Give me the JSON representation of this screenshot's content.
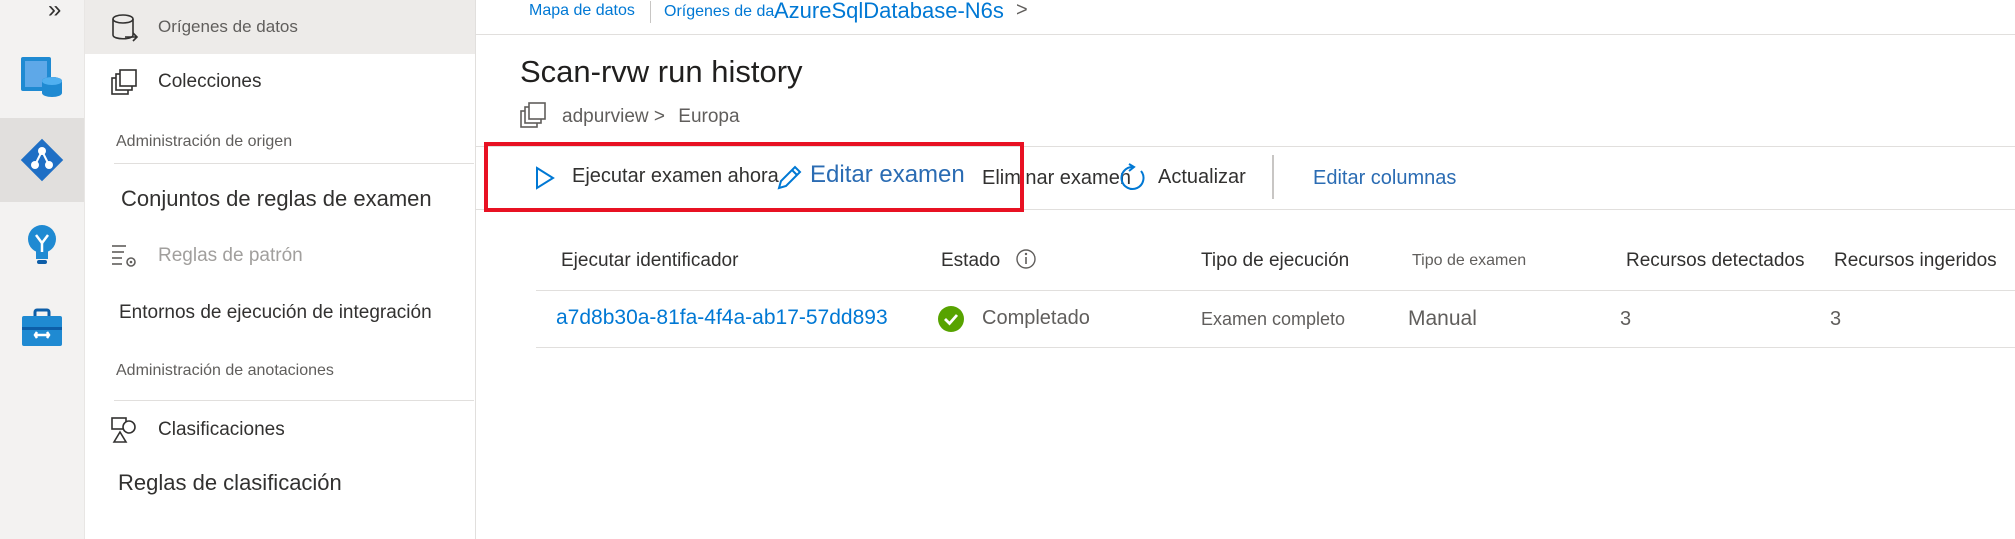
{
  "rail": {
    "expand_glyph": "»",
    "items": [
      {
        "icon": "data-map-icon",
        "active": false
      },
      {
        "icon": "data-catalog-icon",
        "active": true
      },
      {
        "icon": "insights-icon",
        "active": false
      },
      {
        "icon": "management-toolbox-icon",
        "active": false
      }
    ]
  },
  "nav": {
    "data_sources": "Orígenes de datos",
    "collections": "Colecciones",
    "source_management_heading": "Administración de origen",
    "scan_rule_sets": "Conjuntos de reglas de examen",
    "pattern_rules": "Reglas de patrón",
    "integration_runtimes": "Entornos de ejecución de integración",
    "annotation_management_heading": "Administración de anotaciones",
    "classifications": "Clasificaciones",
    "classification_rules": "Reglas de clasificación"
  },
  "breadcrumb": {
    "item1": "Mapa de datos",
    "item2": "Orígenes de da",
    "item3": "AzureSqlDatabase-N6s",
    "separator": ">"
  },
  "page": {
    "title": "Scan-rvw run history",
    "collection": "adpurview",
    "separator": ">",
    "region": "Europa"
  },
  "toolbar": {
    "run_now": "Ejecutar examen ahora",
    "edit_scan": "Editar examen",
    "delete_scan": "Eliminar examen",
    "refresh": "Actualizar",
    "edit_columns": "Editar columnas",
    "highlight_color": "#e81123",
    "accent_color": "#0078d4"
  },
  "table": {
    "columns": {
      "run_id": "Ejecutar identificador",
      "status": "Estado",
      "run_type": "Tipo de ejecución",
      "scan_type": "Tipo de examen",
      "assets_discovered": "Recursos detectados",
      "assets_ingested": "Recursos ingeridos"
    },
    "rows": [
      {
        "run_id": "a7d8b30a-81fa-4f4a-ab17-57dd893",
        "status": "Completado",
        "status_color": "#57a300",
        "run_type": "Examen completo",
        "scan_type": "Manual",
        "assets_discovered": "3",
        "assets_ingested": "3"
      }
    ]
  }
}
